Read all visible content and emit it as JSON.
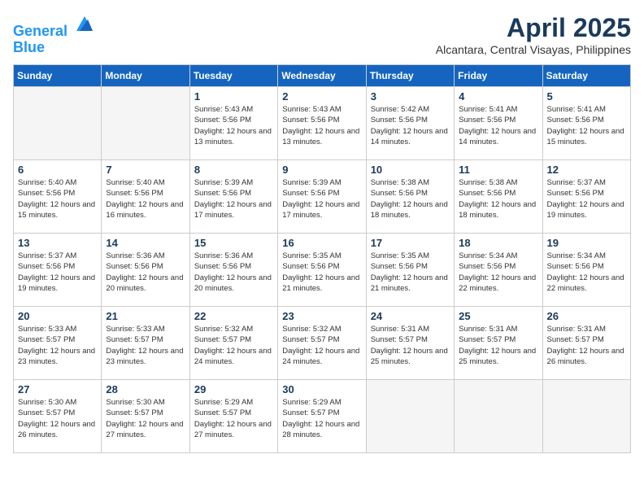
{
  "logo": {
    "line1": "General",
    "line2": "Blue"
  },
  "title": "April 2025",
  "subtitle": "Alcantara, Central Visayas, Philippines",
  "weekdays": [
    "Sunday",
    "Monday",
    "Tuesday",
    "Wednesday",
    "Thursday",
    "Friday",
    "Saturday"
  ],
  "weeks": [
    [
      {
        "day": "",
        "empty": true
      },
      {
        "day": "",
        "empty": true
      },
      {
        "day": "1",
        "sunrise": "Sunrise: 5:43 AM",
        "sunset": "Sunset: 5:56 PM",
        "daylight": "Daylight: 12 hours and 13 minutes."
      },
      {
        "day": "2",
        "sunrise": "Sunrise: 5:43 AM",
        "sunset": "Sunset: 5:56 PM",
        "daylight": "Daylight: 12 hours and 13 minutes."
      },
      {
        "day": "3",
        "sunrise": "Sunrise: 5:42 AM",
        "sunset": "Sunset: 5:56 PM",
        "daylight": "Daylight: 12 hours and 14 minutes."
      },
      {
        "day": "4",
        "sunrise": "Sunrise: 5:41 AM",
        "sunset": "Sunset: 5:56 PM",
        "daylight": "Daylight: 12 hours and 14 minutes."
      },
      {
        "day": "5",
        "sunrise": "Sunrise: 5:41 AM",
        "sunset": "Sunset: 5:56 PM",
        "daylight": "Daylight: 12 hours and 15 minutes."
      }
    ],
    [
      {
        "day": "6",
        "sunrise": "Sunrise: 5:40 AM",
        "sunset": "Sunset: 5:56 PM",
        "daylight": "Daylight: 12 hours and 15 minutes."
      },
      {
        "day": "7",
        "sunrise": "Sunrise: 5:40 AM",
        "sunset": "Sunset: 5:56 PM",
        "daylight": "Daylight: 12 hours and 16 minutes."
      },
      {
        "day": "8",
        "sunrise": "Sunrise: 5:39 AM",
        "sunset": "Sunset: 5:56 PM",
        "daylight": "Daylight: 12 hours and 17 minutes."
      },
      {
        "day": "9",
        "sunrise": "Sunrise: 5:39 AM",
        "sunset": "Sunset: 5:56 PM",
        "daylight": "Daylight: 12 hours and 17 minutes."
      },
      {
        "day": "10",
        "sunrise": "Sunrise: 5:38 AM",
        "sunset": "Sunset: 5:56 PM",
        "daylight": "Daylight: 12 hours and 18 minutes."
      },
      {
        "day": "11",
        "sunrise": "Sunrise: 5:38 AM",
        "sunset": "Sunset: 5:56 PM",
        "daylight": "Daylight: 12 hours and 18 minutes."
      },
      {
        "day": "12",
        "sunrise": "Sunrise: 5:37 AM",
        "sunset": "Sunset: 5:56 PM",
        "daylight": "Daylight: 12 hours and 19 minutes."
      }
    ],
    [
      {
        "day": "13",
        "sunrise": "Sunrise: 5:37 AM",
        "sunset": "Sunset: 5:56 PM",
        "daylight": "Daylight: 12 hours and 19 minutes."
      },
      {
        "day": "14",
        "sunrise": "Sunrise: 5:36 AM",
        "sunset": "Sunset: 5:56 PM",
        "daylight": "Daylight: 12 hours and 20 minutes."
      },
      {
        "day": "15",
        "sunrise": "Sunrise: 5:36 AM",
        "sunset": "Sunset: 5:56 PM",
        "daylight": "Daylight: 12 hours and 20 minutes."
      },
      {
        "day": "16",
        "sunrise": "Sunrise: 5:35 AM",
        "sunset": "Sunset: 5:56 PM",
        "daylight": "Daylight: 12 hours and 21 minutes."
      },
      {
        "day": "17",
        "sunrise": "Sunrise: 5:35 AM",
        "sunset": "Sunset: 5:56 PM",
        "daylight": "Daylight: 12 hours and 21 minutes."
      },
      {
        "day": "18",
        "sunrise": "Sunrise: 5:34 AM",
        "sunset": "Sunset: 5:56 PM",
        "daylight": "Daylight: 12 hours and 22 minutes."
      },
      {
        "day": "19",
        "sunrise": "Sunrise: 5:34 AM",
        "sunset": "Sunset: 5:56 PM",
        "daylight": "Daylight: 12 hours and 22 minutes."
      }
    ],
    [
      {
        "day": "20",
        "sunrise": "Sunrise: 5:33 AM",
        "sunset": "Sunset: 5:57 PM",
        "daylight": "Daylight: 12 hours and 23 minutes."
      },
      {
        "day": "21",
        "sunrise": "Sunrise: 5:33 AM",
        "sunset": "Sunset: 5:57 PM",
        "daylight": "Daylight: 12 hours and 23 minutes."
      },
      {
        "day": "22",
        "sunrise": "Sunrise: 5:32 AM",
        "sunset": "Sunset: 5:57 PM",
        "daylight": "Daylight: 12 hours and 24 minutes."
      },
      {
        "day": "23",
        "sunrise": "Sunrise: 5:32 AM",
        "sunset": "Sunset: 5:57 PM",
        "daylight": "Daylight: 12 hours and 24 minutes."
      },
      {
        "day": "24",
        "sunrise": "Sunrise: 5:31 AM",
        "sunset": "Sunset: 5:57 PM",
        "daylight": "Daylight: 12 hours and 25 minutes."
      },
      {
        "day": "25",
        "sunrise": "Sunrise: 5:31 AM",
        "sunset": "Sunset: 5:57 PM",
        "daylight": "Daylight: 12 hours and 25 minutes."
      },
      {
        "day": "26",
        "sunrise": "Sunrise: 5:31 AM",
        "sunset": "Sunset: 5:57 PM",
        "daylight": "Daylight: 12 hours and 26 minutes."
      }
    ],
    [
      {
        "day": "27",
        "sunrise": "Sunrise: 5:30 AM",
        "sunset": "Sunset: 5:57 PM",
        "daylight": "Daylight: 12 hours and 26 minutes."
      },
      {
        "day": "28",
        "sunrise": "Sunrise: 5:30 AM",
        "sunset": "Sunset: 5:57 PM",
        "daylight": "Daylight: 12 hours and 27 minutes."
      },
      {
        "day": "29",
        "sunrise": "Sunrise: 5:29 AM",
        "sunset": "Sunset: 5:57 PM",
        "daylight": "Daylight: 12 hours and 27 minutes."
      },
      {
        "day": "30",
        "sunrise": "Sunrise: 5:29 AM",
        "sunset": "Sunset: 5:57 PM",
        "daylight": "Daylight: 12 hours and 28 minutes."
      },
      {
        "day": "",
        "empty": true
      },
      {
        "day": "",
        "empty": true
      },
      {
        "day": "",
        "empty": true
      }
    ]
  ]
}
